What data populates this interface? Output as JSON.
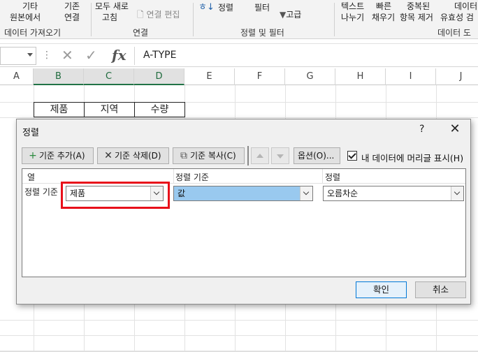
{
  "ribbon": {
    "items": {
      "other_line1": "기타",
      "other_line2": "원본에서",
      "existing_line1": "기존",
      "existing_line2": "연결",
      "refresh_line1": "모두 새로",
      "refresh_line2": "고침",
      "edit_links": "연결 편집",
      "sort": "정렬",
      "filter": "필터",
      "advanced": "고급",
      "text_line1": "텍스트",
      "text_line2": "나누기",
      "flash_line1": "빠른",
      "flash_line2": "채우기",
      "dup_line1": "중복된",
      "dup_line2": "항목 제거",
      "valid_line1": "데이터",
      "valid_line2": "유효성 검"
    },
    "groups": {
      "get_data": "데이터 가져오기",
      "connections": "연결",
      "sort_filter": "정렬 및 필터",
      "data_tools": "데이터 도"
    }
  },
  "formula_bar": {
    "value": "A-TYPE",
    "dots": "⋮",
    "cancel_glyph": "✕",
    "enter_glyph": "✓",
    "fx_label": "fx"
  },
  "sheet": {
    "columns": [
      "A",
      "B",
      "C",
      "D",
      "E",
      "F",
      "G",
      "H",
      "I",
      "J"
    ],
    "table_headers": [
      "제품",
      "지역",
      "수량"
    ]
  },
  "dialog": {
    "title": "정렬",
    "help": "?",
    "close": "✕",
    "toolbar": {
      "add_level": "기준 추가(A)",
      "delete_level": "기준 삭제(D)",
      "copy_level": "기준 복사(C)",
      "options": "옵션(O)...",
      "has_headers_label": "내 데이터에 머리글 표시(H)",
      "has_headers_checked": true
    },
    "columns_header": {
      "column": "열",
      "sort_on": "정렬 기준",
      "order": "정렬"
    },
    "row": {
      "label": "정렬 기준",
      "column_value": "제품",
      "sort_on_value": "값",
      "order_value": "오름차순"
    },
    "ok": "확인",
    "cancel": "취소"
  },
  "colors": {
    "highlight_red": "#e8101a",
    "selected_combo": "#99c9ef",
    "excel_green": "#217346"
  }
}
